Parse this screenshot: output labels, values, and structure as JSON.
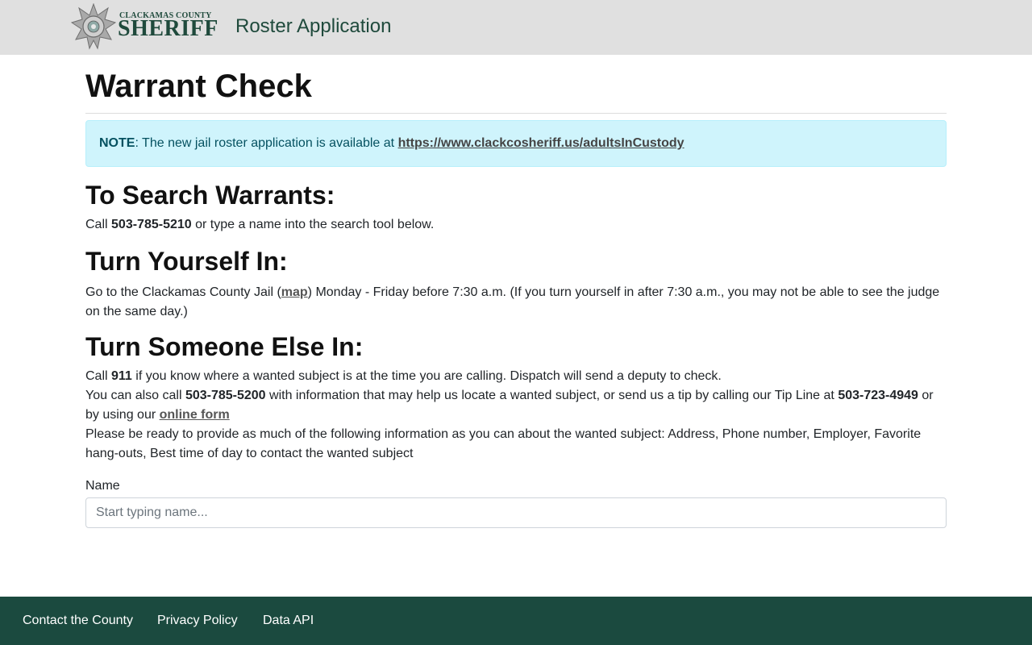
{
  "header": {
    "logo_county": "CLACKAMAS COUNTY",
    "logo_sheriff": "SHERIFF",
    "app_title": "Roster Application"
  },
  "page": {
    "title": "Warrant Check"
  },
  "note": {
    "label": "NOTE",
    "text": ": The new jail roster application is available at ",
    "link": "https://www.clackcosheriff.us/adultsInCustody"
  },
  "search_warrants": {
    "heading": "To Search Warrants:",
    "call": "Call ",
    "phone": "503-785-5210",
    "rest": " or type a name into the search tool below."
  },
  "turn_yourself_in": {
    "heading": "Turn Yourself In:",
    "before": "Go to the Clackamas County Jail (",
    "map_link": "map",
    "after": ") Monday - Friday before 7:30 a.m. (If you turn yourself in after 7:30 a.m., you may not be able to see the judge on the same day.)"
  },
  "turn_someone_in": {
    "heading": "Turn Someone Else In:",
    "l1_call": "Call ",
    "l1_911": "911",
    "l1_rest": " if you know where a wanted subject is at the time you are calling. Dispatch will send a deputy to check.",
    "l2_a": "You can also call ",
    "l2_phone": "503-785-5200",
    "l2_b": " with information that may help us locate a wanted subject, or send us a tip by calling our Tip Line at ",
    "l2_tipline": "503-723-4949",
    "l2_c": " or by using our ",
    "l2_link": "online form",
    "l3": "Please be ready to provide as much of the following information as you can about the wanted subject: Address, Phone number, Employer, Favorite hang-outs, Best time of day to contact the wanted subject"
  },
  "search_form": {
    "label": "Name",
    "placeholder": "Start typing name...",
    "value": ""
  },
  "footer": {
    "links": [
      "Contact the County",
      "Privacy Policy",
      "Data API"
    ]
  },
  "colors": {
    "topbar_bg": "#e0e0e0",
    "brand_green": "#1f4a3c",
    "footer_bg": "#1b4a3f",
    "alert_bg": "#cff4fc",
    "alert_text": "#055160"
  },
  "icons": {
    "logo_badge": "sheriff-star-badge-icon"
  }
}
